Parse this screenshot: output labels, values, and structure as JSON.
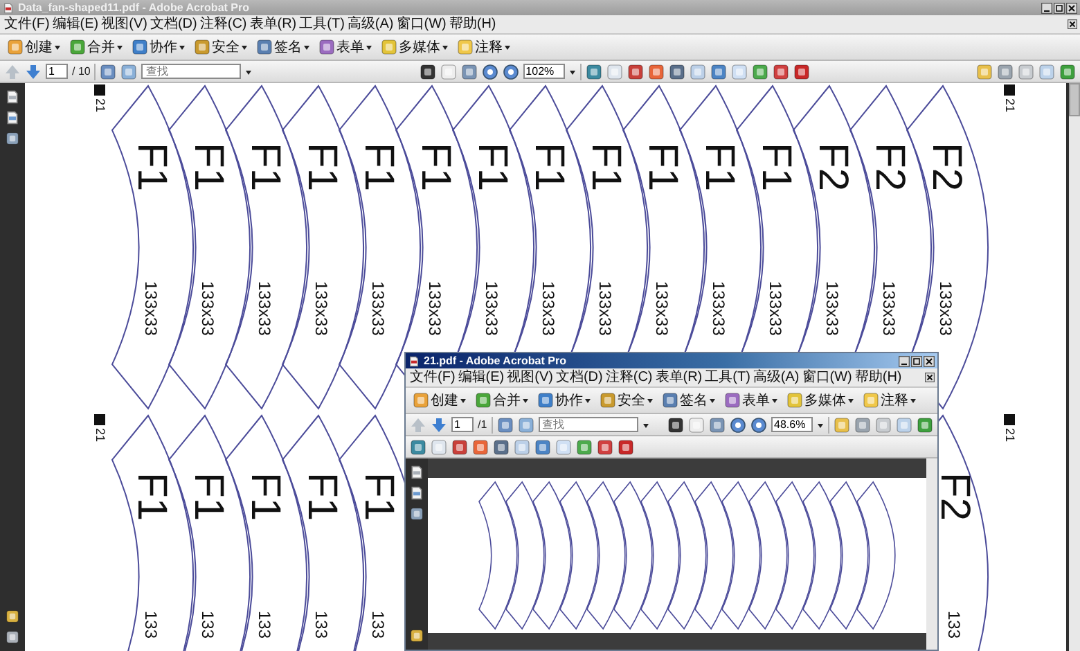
{
  "main_window": {
    "title": "Data_fan-shaped11.pdf - Adobe Acrobat Pro",
    "active": false,
    "menu": [
      "文件(F)",
      "编辑(E)",
      "视图(V)",
      "文档(D)",
      "注释(C)",
      "表单(R)",
      "工具(T)",
      "高级(A)",
      "窗口(W)",
      "帮助(H)"
    ],
    "toolbar": [
      "创建",
      "合并",
      "协作",
      "安全",
      "签名",
      "表单",
      "多媒体",
      "注释"
    ],
    "nav": {
      "page": "1",
      "page_count": "/ 10",
      "search_placeholder": "查找",
      "zoom": "102%"
    }
  },
  "document": {
    "rows": [
      {
        "markers": [
          "21",
          "21"
        ],
        "fans": [
          {
            "code": "F1",
            "size": "133x33"
          },
          {
            "code": "F1",
            "size": "133x33"
          },
          {
            "code": "F1",
            "size": "133x33"
          },
          {
            "code": "F1",
            "size": "133x33"
          },
          {
            "code": "F1",
            "size": "133x33"
          },
          {
            "code": "F1",
            "size": "133x33"
          },
          {
            "code": "F1",
            "size": "133x33"
          },
          {
            "code": "F1",
            "size": "133x33"
          },
          {
            "code": "F1",
            "size": "133x33"
          },
          {
            "code": "F1",
            "size": "133x33"
          },
          {
            "code": "F1",
            "size": "133x33"
          },
          {
            "code": "F1",
            "size": "133x33"
          },
          {
            "code": "F2",
            "size": "133x33"
          },
          {
            "code": "F2",
            "size": "133x33"
          },
          {
            "code": "F2",
            "size": "133x33"
          }
        ]
      },
      {
        "markers": [
          "21",
          "21"
        ],
        "fans": [
          {
            "code": "F1",
            "size": "133"
          },
          {
            "code": "F1",
            "size": "133"
          },
          {
            "code": "F1",
            "size": "133"
          },
          {
            "code": "F1",
            "size": "133"
          },
          {
            "code": "F1",
            "size": "133"
          },
          {
            "code": "F2",
            "size": "133",
            "kind": "end"
          }
        ]
      }
    ]
  },
  "child_window": {
    "title": "21.pdf - Adobe Acrobat Pro",
    "active": true,
    "menu": [
      "文件(F)",
      "编辑(E)",
      "视图(V)",
      "文档(D)",
      "注释(C)",
      "表单(R)",
      "工具(T)",
      "高级(A)",
      "窗口(W)",
      "帮助(H)"
    ],
    "toolbar": [
      "创建",
      "合并",
      "协作",
      "安全",
      "签名",
      "表单",
      "多媒体",
      "注释"
    ],
    "nav": {
      "page": "1",
      "page_count": "/1",
      "search_placeholder": "查找",
      "zoom": "48.6%"
    }
  }
}
